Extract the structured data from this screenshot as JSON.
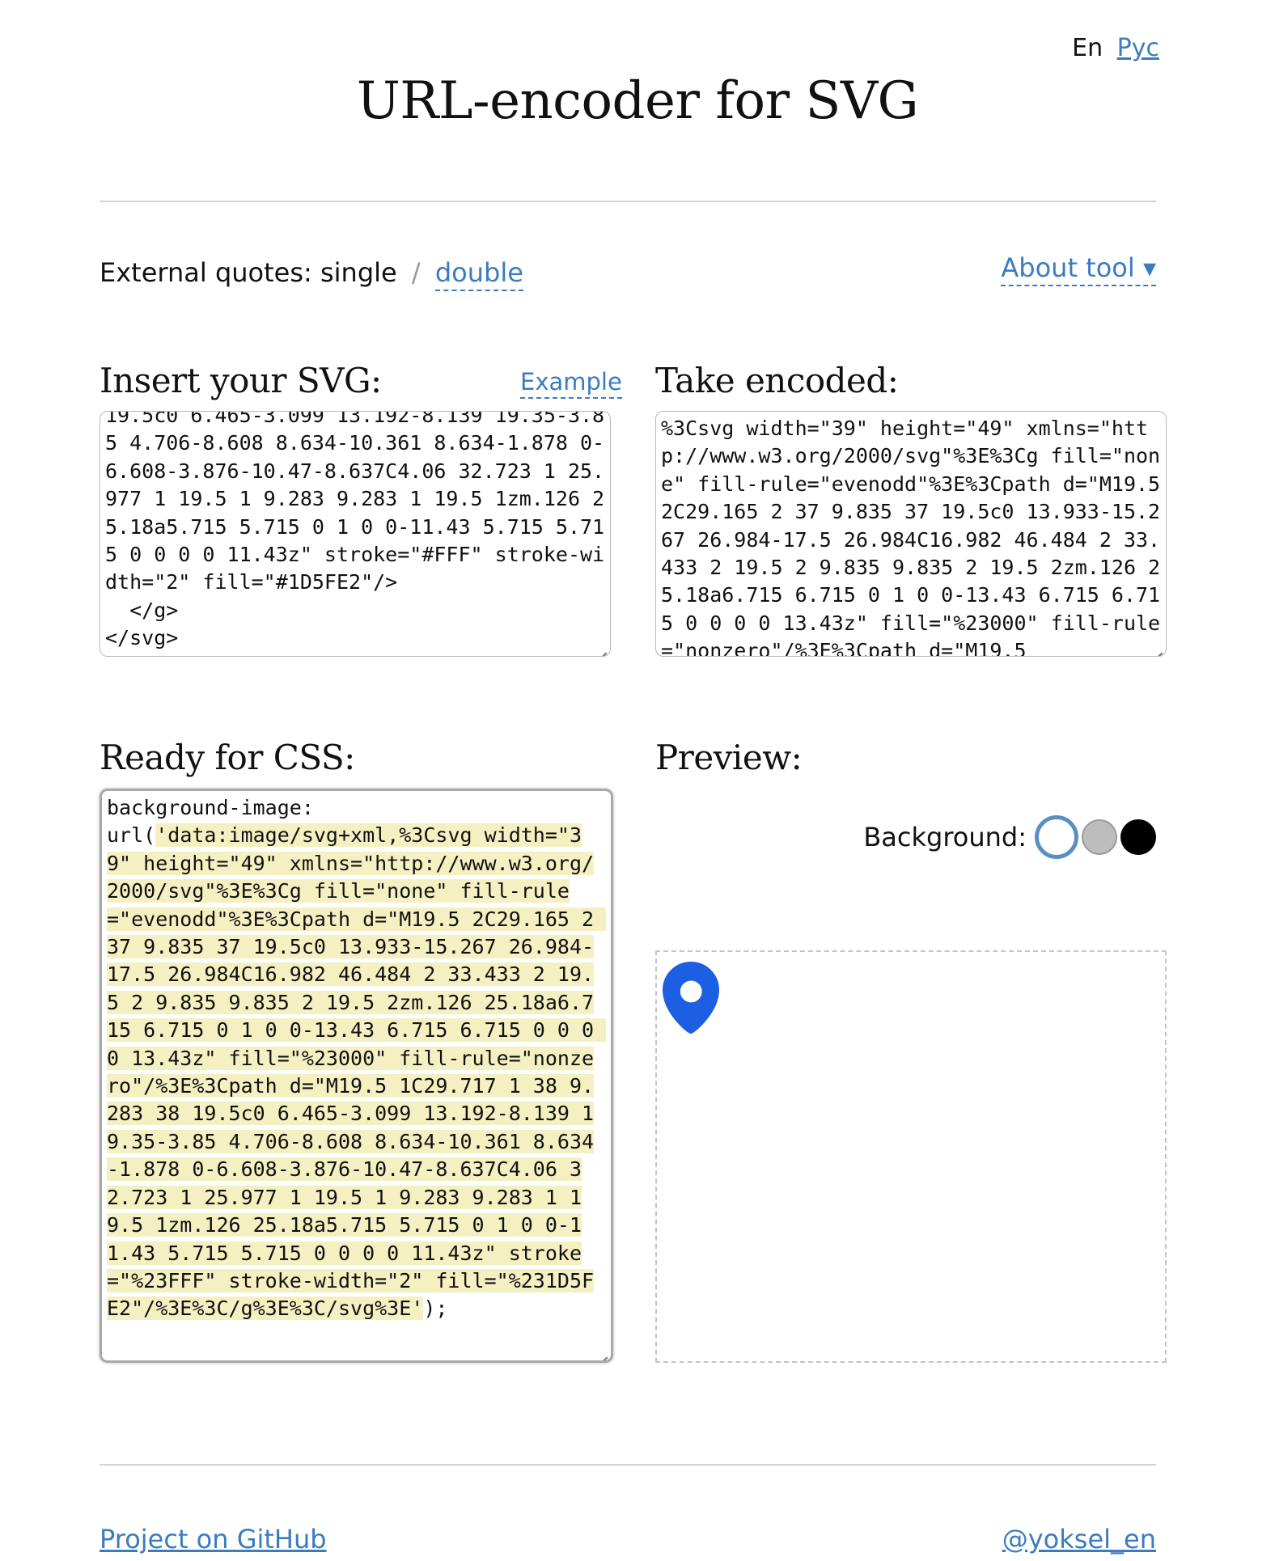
{
  "lang": {
    "current": "En",
    "other": "Рус"
  },
  "title": "URL-encoder for SVG",
  "quotes": {
    "label": "External quotes:",
    "active": "single",
    "separator": "/",
    "alternative": "double"
  },
  "about_label": "About tool ▾",
  "insert": {
    "heading": "Insert your SVG:",
    "example_label": "Example",
    "value": "19.5c0 6.465-3.099 13.192-8.139 19.35-3.85 4.706-8.608 8.634-10.361 8.634-1.878 0-6.608-3.876-10.47-8.637C4.06 32.723 1 25.977 1 19.5 1 9.283 9.283 1 19.5 1zm.126 25.18a5.715 5.715 0 1 0 0-11.43 5.715 5.715 0 0 0 0 11.43z\" stroke=\"#FFF\" stroke-width=\"2\" fill=\"#1D5FE2\"/>\n  </g>\n</svg>"
  },
  "encoded": {
    "heading": "Take encoded:",
    "value": "%3Csvg width=\"39\" height=\"49\" xmlns=\"http://www.w3.org/2000/svg\"%3E%3Cg fill=\"none\" fill-rule=\"evenodd\"%3E%3Cpath d=\"M19.5 2C29.165 2 37 9.835 37 19.5c0 13.933-15.267 26.984-17.5 26.984C16.982 46.484 2 33.433 2 19.5 2 9.835 9.835 2 19.5 2zm.126 25.18a6.715 6.715 0 1 0 0-13.43 6.715 6.715 0 0 0 0 13.43z\" fill=\"%23000\" fill-rule=\"nonzero\"/%3E%3Cpath d=\"M19.5"
  },
  "css": {
    "heading": "Ready for CSS:",
    "prefix": "background-image:\nurl(",
    "highlighted": "'data:image/svg+xml,%3Csvg width=\"39\" height=\"49\" xmlns=\"http://www.w3.org/2000/svg\"%3E%3Cg fill=\"none\" fill-rule=\"evenodd\"%3E%3Cpath d=\"M19.5 2C29.165 2 37 9.835 37 19.5c0 13.933-15.267 26.984-17.5 26.984C16.982 46.484 2 33.433 2 19.5 2 9.835 9.835 2 19.5 2zm.126 25.18a6.715 6.715 0 1 0 0-13.43 6.715 6.715 0 0 0 0 13.43z\" fill=\"%23000\" fill-rule=\"nonzero\"/%3E%3Cpath d=\"M19.5 1C29.717 1 38 9.283 38 19.5c0 6.465-3.099 13.192-8.139 19.35-3.85 4.706-8.608 8.634-10.361 8.634-1.878 0-6.608-3.876-10.47-8.637C4.06 32.723 1 25.977 1 19.5 1 9.283 9.283 1 19.5 1zm.126 25.18a5.715 5.715 0 1 0 0-11.43 5.715 5.715 0 0 0 0 11.43z\" stroke=\"%23FFF\" stroke-width=\"2\" fill=\"%231D5FE2\"/%3E%3C/g%3E%3C/svg%3E'",
    "suffix": ");"
  },
  "preview": {
    "heading": "Preview:",
    "background_label": "Background:",
    "background_options": [
      "white",
      "grey",
      "black"
    ],
    "selected_background": "white",
    "icon": "map-pin-icon",
    "pin_color": "#1D5FE2"
  },
  "footer": {
    "github": "Project on GitHub",
    "twitter": "@yoksel_en"
  },
  "colors": {
    "link": "#3a7cbf",
    "highlight": "#f5f0c2"
  }
}
